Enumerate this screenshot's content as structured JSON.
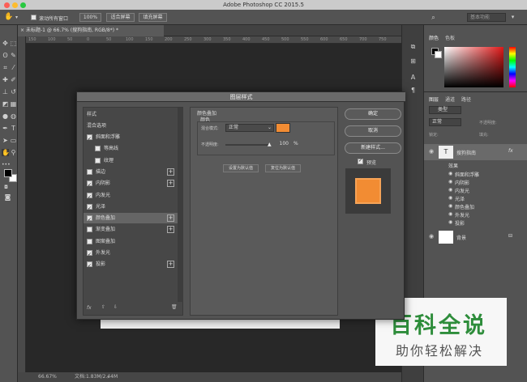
{
  "window": {
    "title": "Adobe Photoshop CC 2015.5"
  },
  "options": {
    "scroll_all_label": "滚动所有窗口",
    "zoom100": "100%",
    "fit_screen": "适合屏幕",
    "fill_screen": "填充屏幕",
    "workspace": "基本功能"
  },
  "document": {
    "tab": "未标题-1 @ 66.7% (搜狗指南, RGB/8*) *"
  },
  "ruler": {
    "ticks": [
      "150",
      "100",
      "50",
      "0",
      "50",
      "100",
      "150",
      "200",
      "250",
      "300",
      "350",
      "400",
      "450",
      "500",
      "550",
      "600",
      "650",
      "700",
      "750"
    ]
  },
  "status": {
    "zoom": "66.67%",
    "doc": "文档:1.83M/2.44M"
  },
  "color_panel": {
    "tab1": "颜色",
    "tab2": "色板"
  },
  "layers_panel": {
    "tabs": [
      "图层",
      "通道",
      "路径"
    ],
    "kind": "类型",
    "mode": "正常",
    "opacity": "不透明度:",
    "lock": "锁定:",
    "fill": "填充:",
    "text_layer": "搜狗指南",
    "effects_label": "效果",
    "effects": [
      "斜面和浮雕",
      "内阴影",
      "内发光",
      "光泽",
      "颜色叠加",
      "外发光",
      "投影"
    ],
    "bg_layer": "背景"
  },
  "dialog": {
    "title": "图层样式",
    "styles_header": "样式",
    "blend_options": "混合选项",
    "items": [
      {
        "label": "斜面和浮雕",
        "checked": true,
        "plus": false,
        "indent": false
      },
      {
        "label": "等高线",
        "checked": false,
        "plus": false,
        "indent": true
      },
      {
        "label": "纹理",
        "checked": false,
        "plus": false,
        "indent": true
      },
      {
        "label": "描边",
        "checked": false,
        "plus": true,
        "indent": false
      },
      {
        "label": "内阴影",
        "checked": true,
        "plus": true,
        "indent": false
      },
      {
        "label": "内发光",
        "checked": true,
        "plus": false,
        "indent": false
      },
      {
        "label": "光泽",
        "checked": true,
        "plus": false,
        "indent": false
      },
      {
        "label": "颜色叠加",
        "checked": true,
        "plus": true,
        "indent": false
      },
      {
        "label": "渐变叠加",
        "checked": false,
        "plus": true,
        "indent": false
      },
      {
        "label": "图案叠加",
        "checked": false,
        "plus": false,
        "indent": false
      },
      {
        "label": "外发光",
        "checked": true,
        "plus": false,
        "indent": false
      },
      {
        "label": "投影",
        "checked": true,
        "plus": true,
        "indent": false
      }
    ],
    "fx_label": "fx",
    "section_title": "颜色叠加",
    "group_title": "颜色",
    "blend_mode_label": "混合模式:",
    "blend_mode_value": "正常",
    "opacity_label": "不透明度:",
    "opacity_value": "100",
    "opacity_unit": "%",
    "opacity_fraction": 1.0,
    "overlay_color": "#f28c33",
    "set_default": "设置为默认值",
    "reset_default": "复位为默认值",
    "ok": "确定",
    "cancel": "取消",
    "new_style": "新建样式...",
    "preview_label": "预览",
    "preview_checked": true
  },
  "watermark": {
    "line1": "百科全说",
    "line2": "助你轻松解决"
  }
}
